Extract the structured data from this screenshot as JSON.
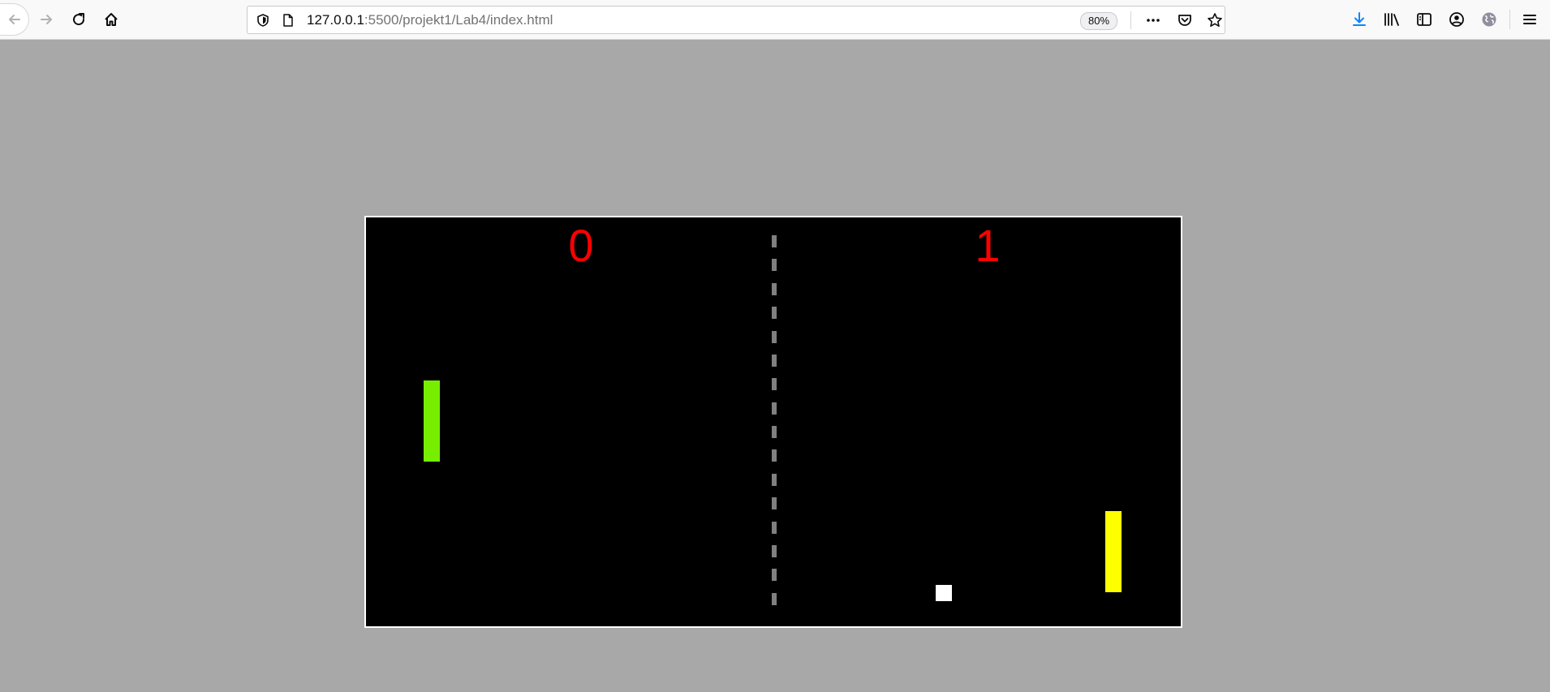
{
  "browser": {
    "url_host": "127.0.0.1",
    "url_path": ":5500/projekt1/Lab4/index.html",
    "zoom": "80%",
    "icons": {
      "back": "back-arrow-icon",
      "forward": "forward-arrow-icon",
      "reload": "reload-icon",
      "home": "home-icon",
      "tracking": "tracking-protection-shield-icon",
      "page": "page-icon",
      "more": "more-dots-icon",
      "pocket": "pocket-icon",
      "bookmark": "star-icon",
      "downloads": "download-arrow-icon",
      "library": "library-icon",
      "sidebar": "sidebar-icon",
      "account": "account-icon",
      "extension": "extension-globe-icon",
      "menu": "hamburger-menu-icon"
    },
    "accent_color": "#0a84ff"
  },
  "game": {
    "score_left": "0",
    "score_right": "1",
    "colors": {
      "background": "#000000",
      "border": "#ffffff",
      "score": "#ff0000",
      "net": "#808080",
      "paddle_left": "#77ee00",
      "paddle_right": "#ffff00",
      "ball": "#ffffff",
      "page": "#a8a8a8"
    },
    "net_dash_count": 16
  }
}
